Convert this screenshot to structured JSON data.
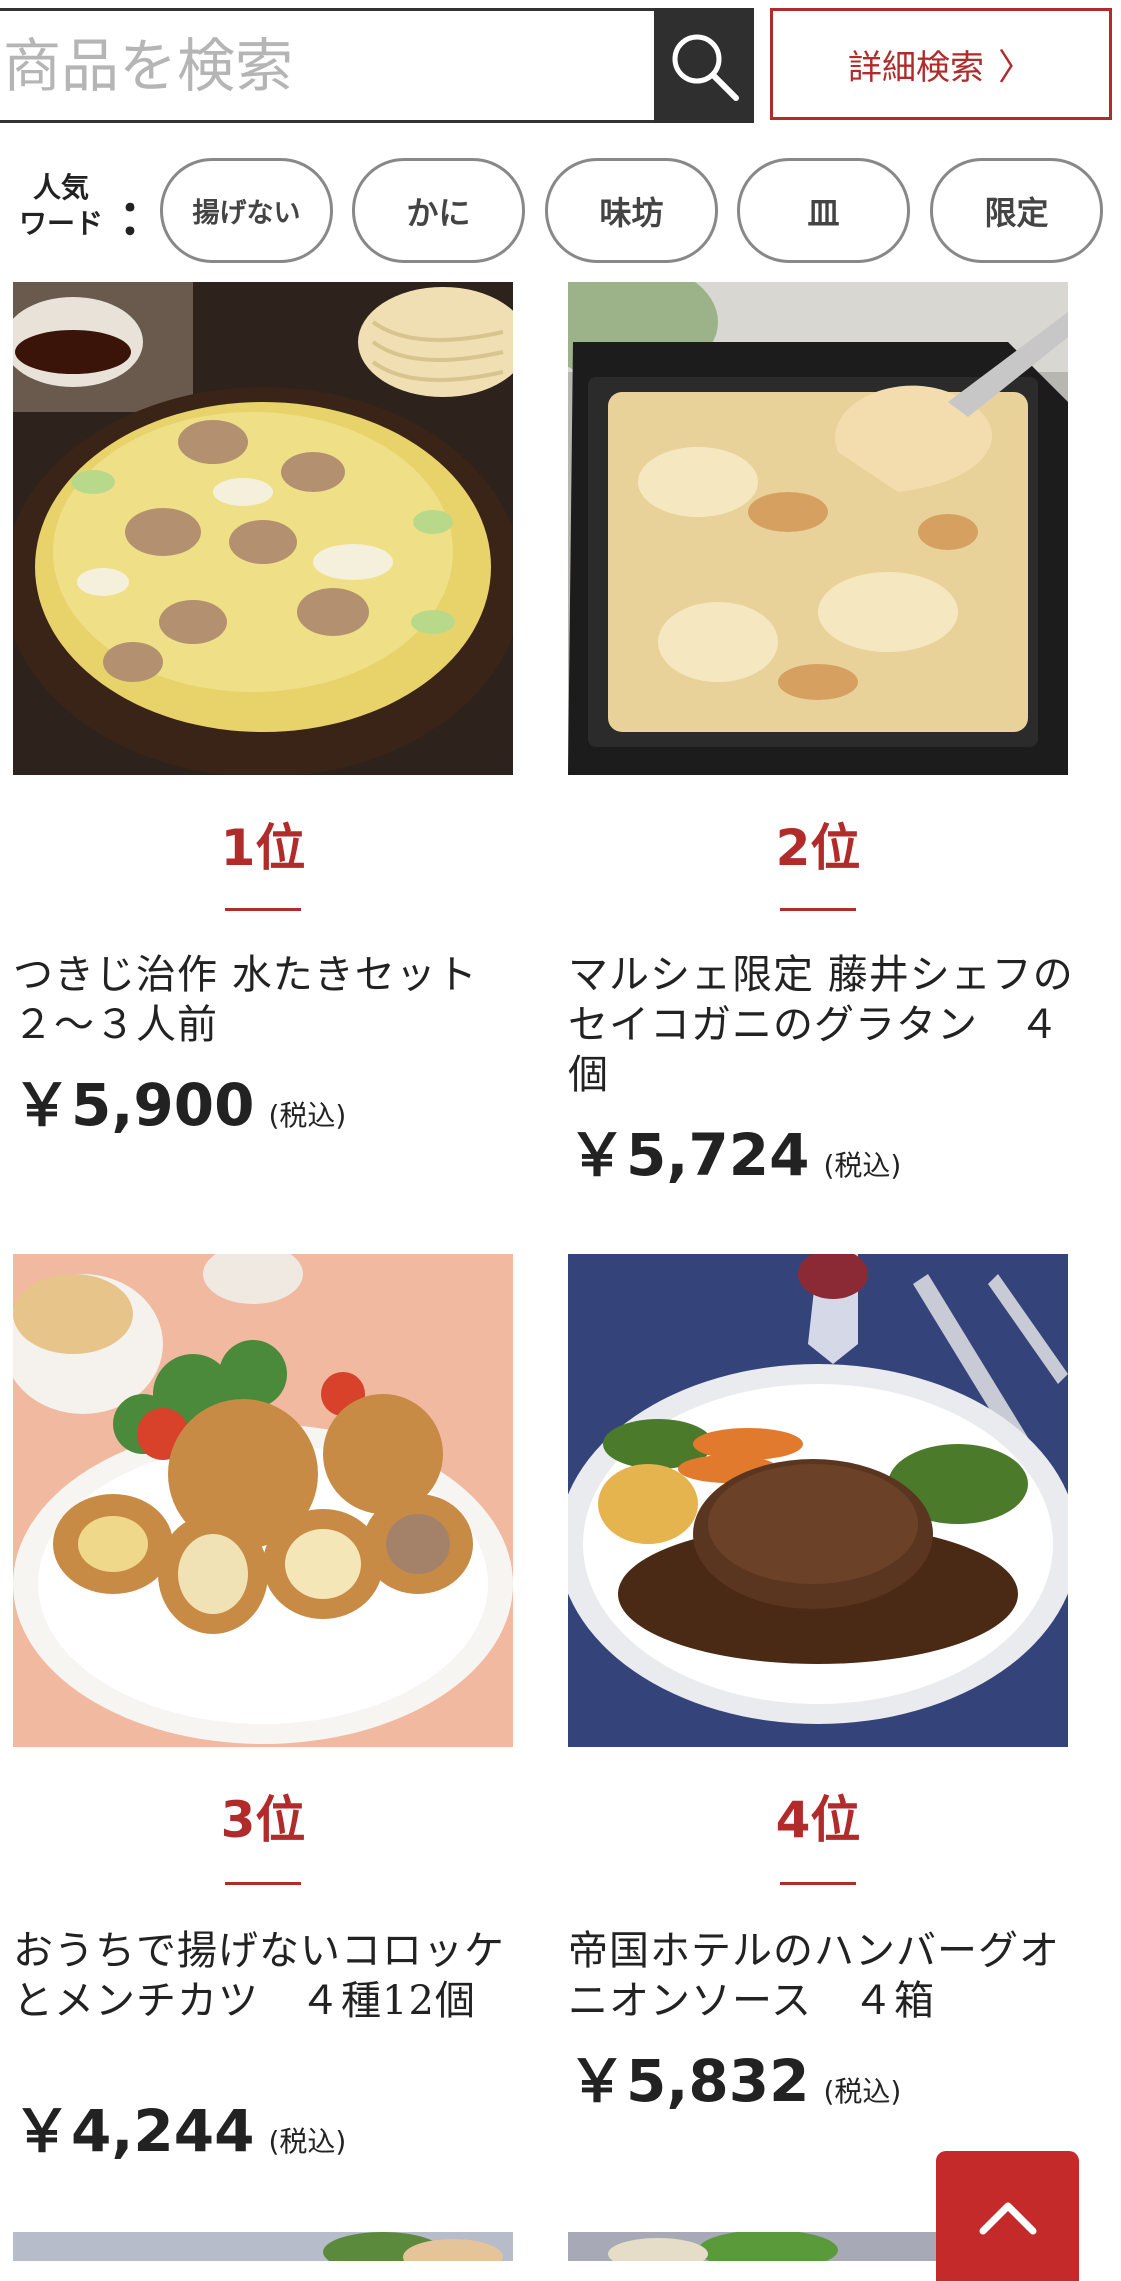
{
  "search": {
    "placeholder": "商品を検索",
    "advanced_label": "詳細検索",
    "advanced_chevron": "〉"
  },
  "popular": {
    "label_line1": "人気",
    "label_line2": "ワード",
    "separator": "：",
    "chips": [
      "揚げない",
      "かに",
      "味坊",
      "皿",
      "限定"
    ]
  },
  "products": [
    {
      "rank": "1位",
      "name": "つきじ治作 水たきセット ２〜３人前",
      "price": "￥5,900",
      "tax": "(税込)"
    },
    {
      "rank": "2位",
      "name": "マルシェ限定 藤井シェフのセイコガニのグラタン　４個",
      "price": "￥5,724",
      "tax": "(税込)"
    },
    {
      "rank": "3位",
      "name": "おうちで揚げないコロッケとメンチカツ　４種12個",
      "price": "￥4,244",
      "tax": "(税込)"
    },
    {
      "rank": "4位",
      "name": "帝国ホテルのハンバーグオニオンソース　４箱",
      "price": "￥5,832",
      "tax": "(税込)"
    }
  ],
  "colors": {
    "accent": "#b22b2b",
    "pagetop": "#c42a2a",
    "search_button": "#2f2f2f"
  },
  "icons": {
    "search": "search-icon",
    "pagetop": "chevron-up-icon"
  }
}
